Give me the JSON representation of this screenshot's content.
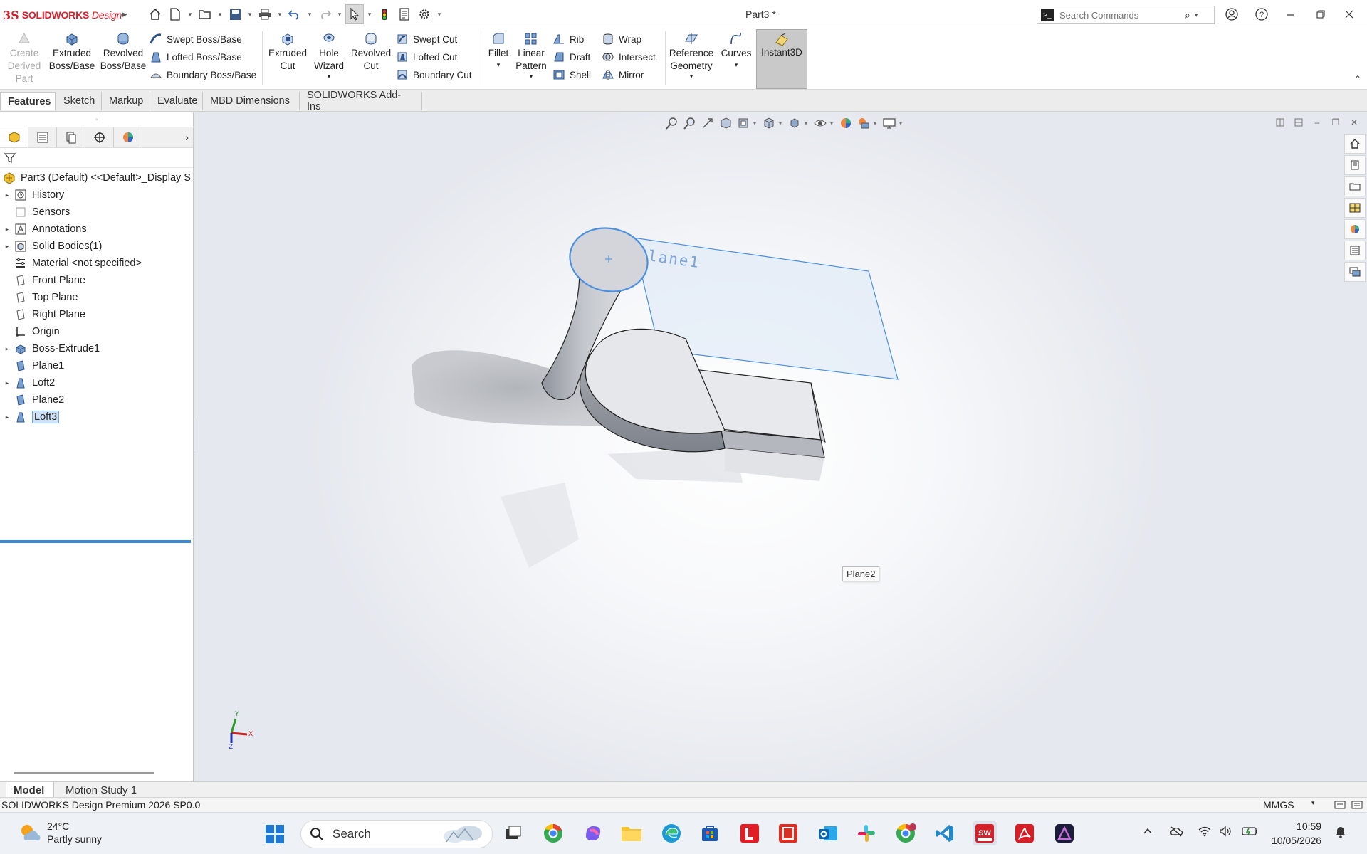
{
  "app": {
    "logo_ds": "3S",
    "logo_brand": "SOLIDWORKS",
    "logo_edition": "Design",
    "doc_title": "Part3 *",
    "search_placeholder": "Search Commands"
  },
  "ribbon": {
    "create_derived": [
      "Create",
      "Derived",
      "Part"
    ],
    "extruded_boss": [
      "Extruded",
      "Boss/Base"
    ],
    "revolved_boss": [
      "Revolved",
      "Boss/Base"
    ],
    "swept_boss": "Swept Boss/Base",
    "lofted_boss": "Lofted Boss/Base",
    "boundary_boss": "Boundary Boss/Base",
    "extruded_cut": [
      "Extruded",
      "Cut"
    ],
    "hole_wizard": [
      "Hole",
      "Wizard"
    ],
    "revolved_cut": [
      "Revolved",
      "Cut"
    ],
    "swept_cut": "Swept Cut",
    "lofted_cut": "Lofted Cut",
    "boundary_cut": "Boundary Cut",
    "fillet": "Fillet",
    "linear_pattern": [
      "Linear",
      "Pattern"
    ],
    "rib": "Rib",
    "draft": "Draft",
    "shell": "Shell",
    "wrap": "Wrap",
    "intersect": "Intersect",
    "mirror": "Mirror",
    "reference_geometry": [
      "Reference",
      "Geometry"
    ],
    "curves": "Curves",
    "instant3d": "Instant3D"
  },
  "tabs": [
    "Features",
    "Sketch",
    "Markup",
    "Evaluate",
    "MBD Dimensions",
    "SOLIDWORKS Add-Ins"
  ],
  "tree": {
    "root": "Part3 (Default) <<Default>_Display S",
    "items": [
      {
        "label": "History",
        "icon": "history-icon",
        "expandable": true
      },
      {
        "label": "Sensors",
        "icon": "sensors-icon",
        "expandable": false
      },
      {
        "label": "Annotations",
        "icon": "annotations-icon",
        "expandable": true
      },
      {
        "label": "Solid Bodies(1)",
        "icon": "solid-bodies-icon",
        "expandable": true
      },
      {
        "label": "Material <not specified>",
        "icon": "material-icon",
        "expandable": false
      },
      {
        "label": "Front Plane",
        "icon": "plane-icon",
        "expandable": false
      },
      {
        "label": "Top Plane",
        "icon": "plane-icon",
        "expandable": false
      },
      {
        "label": "Right Plane",
        "icon": "plane-icon",
        "expandable": false
      },
      {
        "label": "Origin",
        "icon": "origin-icon",
        "expandable": false
      },
      {
        "label": "Boss-Extrude1",
        "icon": "extrude-icon",
        "expandable": true
      },
      {
        "label": "Plane1",
        "icon": "ref-plane-icon",
        "expandable": false
      },
      {
        "label": "Loft2",
        "icon": "loft-icon",
        "expandable": true
      },
      {
        "label": "Plane2",
        "icon": "ref-plane-icon",
        "expandable": false
      },
      {
        "label": "Loft3",
        "icon": "loft-icon",
        "expandable": true,
        "selected": true
      }
    ]
  },
  "viewport": {
    "plane1_label": "Plane1",
    "tooltip": "Plane2",
    "triad": {
      "x": "X",
      "y": "Y",
      "z": "Z"
    }
  },
  "bottom_tabs": [
    "Model",
    "Motion Study 1"
  ],
  "status": {
    "product": "SOLIDWORKS Design Premium 2026 SP0.0",
    "units": "MMGS"
  },
  "taskbar": {
    "temp": "24°C",
    "weather": "Partly sunny",
    "search": "Search",
    "time": "10:59",
    "date": "10/05/2026"
  },
  "colors": {
    "brand_red": "#d6202a",
    "selection_blue": "#3b8ad9",
    "plane_outline": "#4a90e2"
  }
}
